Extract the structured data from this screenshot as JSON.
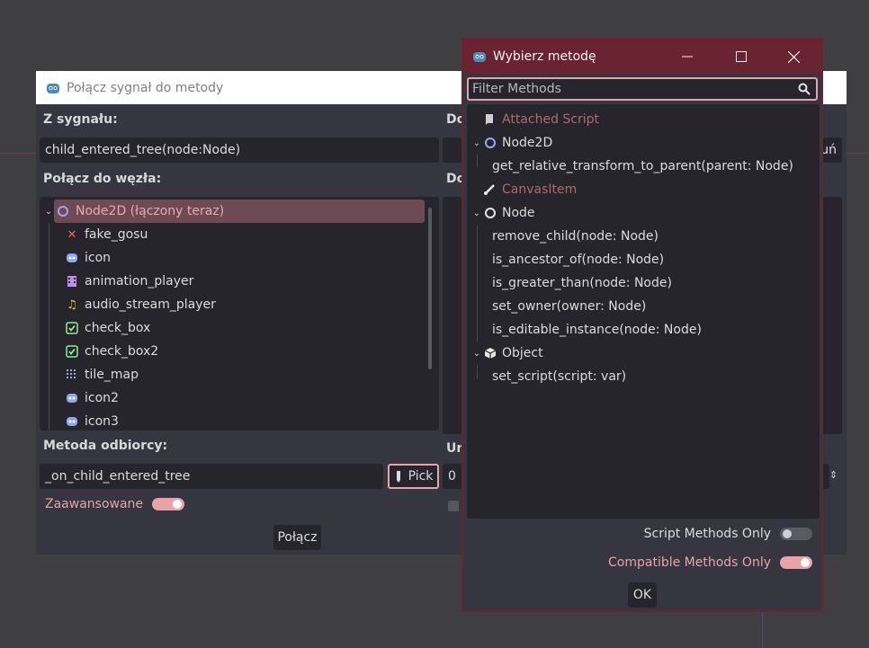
{
  "connect_dialog": {
    "title": "Połącz sygnał do metody",
    "from_signal_label": "Z sygnału:",
    "signal_value": "child_entered_tree(node:Node)",
    "to_node_label": "Połącz do węzła:",
    "right_label_top": "Do",
    "right_label_mid": "Do",
    "right_label_low": "Un",
    "right_field_partial": "uń",
    "right_spin_value": "0",
    "tree_items": [
      {
        "label": "Node2D (łączony teraz)",
        "icon": "node2d-icon"
      },
      {
        "label": "fake_gosu",
        "icon": "error-x-icon"
      },
      {
        "label": "icon",
        "icon": "godot-icon"
      },
      {
        "label": "animation_player",
        "icon": "animation-player-icon"
      },
      {
        "label": "audio_stream_player",
        "icon": "audio-icon"
      },
      {
        "label": "check_box",
        "icon": "checkbox-icon"
      },
      {
        "label": "check_box2",
        "icon": "checkbox-icon"
      },
      {
        "label": "tile_map",
        "icon": "tilemap-icon"
      },
      {
        "label": "icon2",
        "icon": "godot-icon"
      },
      {
        "label": "icon3",
        "icon": "godot-icon"
      }
    ],
    "receiver_label": "Metoda odbiorcy:",
    "receiver_value": "_on_child_entered_tree",
    "pick_label": "Pick",
    "advanced_label": "Zaawansowane",
    "connect_button": "Połącz"
  },
  "method_dialog": {
    "title": "Wybierz metodę",
    "filter_placeholder": "Filter Methods",
    "sections": [
      {
        "label": "Attached Script",
        "kind": "header-muted",
        "icon": "script-icon"
      },
      {
        "label": "Node2D",
        "kind": "group",
        "icon": "node2d-icon",
        "methods": [
          "get_relative_transform_to_parent(parent: Node)"
        ]
      },
      {
        "label": "CanvasItem",
        "kind": "header-muted",
        "icon": "brush-icon"
      },
      {
        "label": "Node",
        "kind": "group",
        "icon": "node-icon",
        "methods": [
          "remove_child(node: Node)",
          "is_ancestor_of(node: Node)",
          "is_greater_than(node: Node)",
          "set_owner(owner: Node)",
          "is_editable_instance(node: Node)"
        ]
      },
      {
        "label": "Object",
        "kind": "group",
        "icon": "object-icon",
        "methods": [
          "set_script(script: var)"
        ]
      }
    ],
    "script_methods_only": "Script Methods Only",
    "compatible_methods_only": "Compatible Methods Only",
    "ok_button": "OK"
  },
  "colors": {
    "accent": "#e7a3a8",
    "title_bar": "#6a2330",
    "panel": "#363640",
    "field": "#25252b",
    "background": "#3f3f42"
  }
}
